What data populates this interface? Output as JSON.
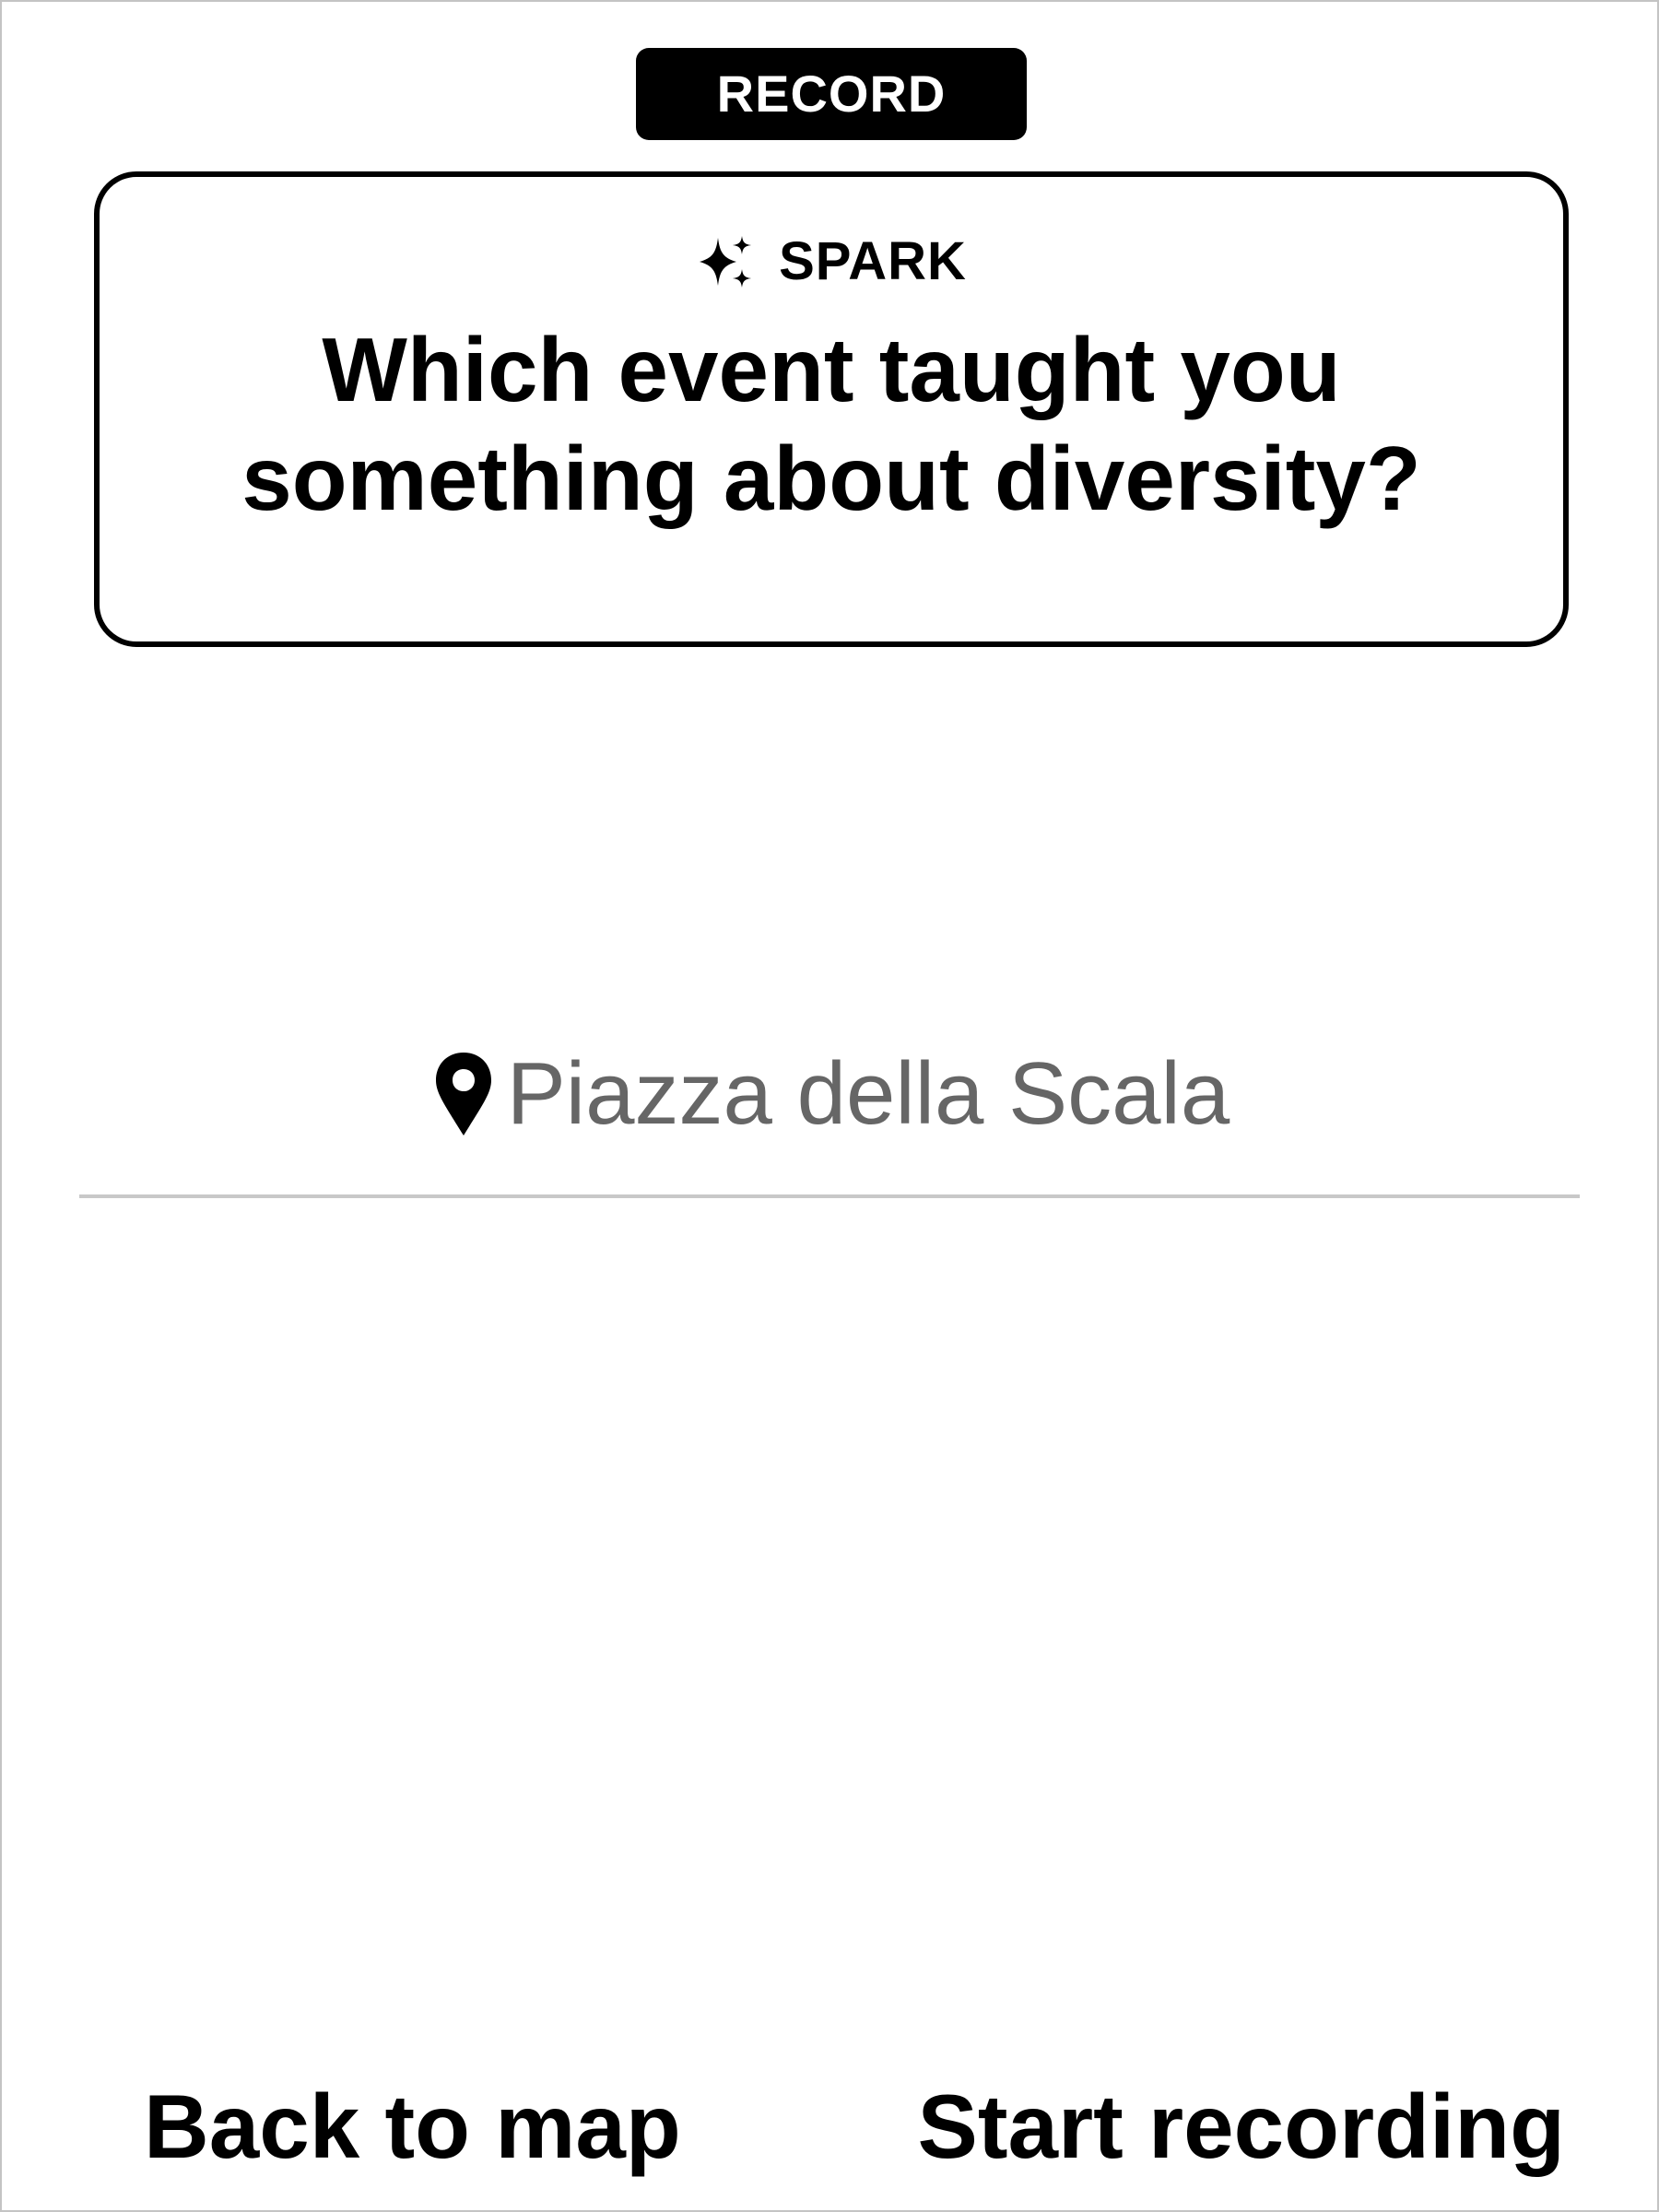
{
  "header": {
    "mode_label": "RECORD"
  },
  "prompt_card": {
    "icon": "sparkle-icon",
    "label": "SPARK",
    "question_line_1": "Which event taught you",
    "question_line_2": "something about diversity?"
  },
  "location": {
    "icon": "map-pin-icon",
    "name": "Piazza della Scala"
  },
  "actions": {
    "back_label": "Back to map",
    "start_label": "Start recording"
  },
  "colors": {
    "background": "#ffffff",
    "foreground": "#000000",
    "location_text": "#666666",
    "divider": "#c8c8c8",
    "frame_border": "#c4c4c4"
  }
}
